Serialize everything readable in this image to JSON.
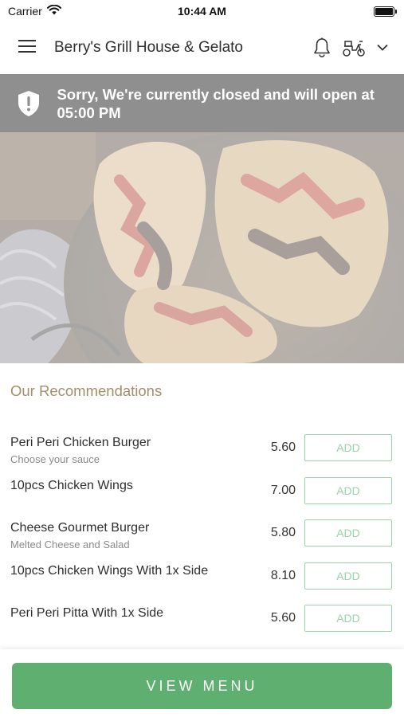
{
  "status_bar": {
    "carrier": "Carrier",
    "time": "10:44 AM"
  },
  "header": {
    "title": "Berry's Grill House & Gelato"
  },
  "banner": {
    "message": "Sorry, We're currently closed and will open at 05:00 PM"
  },
  "recommendations": {
    "title": "Our Recommendations",
    "items": [
      {
        "name": "Peri Peri Chicken Burger",
        "description": "Choose your sauce",
        "price": "5.60",
        "button": "ADD"
      },
      {
        "name": "10pcs Chicken Wings",
        "description": "",
        "price": "7.00",
        "button": "ADD"
      },
      {
        "name": "Cheese Gourmet Burger",
        "description": "Melted Cheese and Salad",
        "price": "5.80",
        "button": "ADD"
      },
      {
        "name": "10pcs Chicken Wings With 1x Side",
        "description": "",
        "price": "8.10",
        "button": "ADD"
      },
      {
        "name": "Peri Peri Pitta With 1x Side",
        "description": "",
        "price": "5.60",
        "button": "ADD"
      }
    ]
  },
  "footer": {
    "view_menu_label": "VIEW MENU"
  },
  "icons": {
    "menu": "hamburger-menu-icon",
    "notifications": "bell-icon",
    "delivery": "scooter-icon",
    "dropdown": "chevron-down-icon",
    "alert": "shield-alert-icon"
  },
  "colors": {
    "accent_green": "#5faf70",
    "add_button": "#9bd2aa",
    "section_title": "#a28f6a",
    "banner_bg": "#8f8f8f"
  }
}
